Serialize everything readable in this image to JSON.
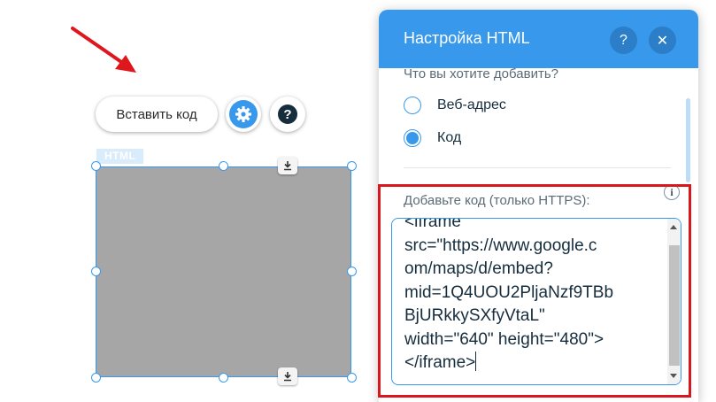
{
  "toolbar": {
    "insert_code_label": "Вставить код",
    "help_glyph": "?"
  },
  "element": {
    "tag_label": "HTML"
  },
  "panel": {
    "title": "Настройка HTML",
    "help_glyph": "?",
    "close_glyph": "✕",
    "question": "Что вы хотите добавить?",
    "options": [
      {
        "label": "Веб-адрес",
        "checked": false
      },
      {
        "label": "Код",
        "checked": true
      }
    ],
    "code_label": "Добавьте код (только HTTPS):",
    "info_glyph": "i",
    "code_lines": [
      "<iframe",
      "src=\"https://www.google.c",
      "om/maps/d/embed?",
      "mid=1Q4UOU2PljaNzf9TBb",
      "BjURkkySXfyVtaL\"",
      "width=\"640\" height=\"480\">",
      "</iframe>"
    ]
  },
  "colors": {
    "accent": "#3899ec",
    "header_dark": "#2b7ec7",
    "highlight": "#d9181e",
    "arrow": "#e0161d",
    "placeholder_box": "#a6a6a6"
  },
  "icons": {
    "arrow": "red-arrow-icon",
    "gear": "gear-icon",
    "help": "question-icon",
    "stretch": "stretch-down-icon",
    "close": "close-icon",
    "info": "info-icon"
  }
}
